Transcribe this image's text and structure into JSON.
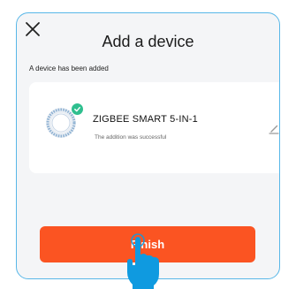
{
  "dialog": {
    "title": "Add a device",
    "subtitle": "A device has been added",
    "close_icon": "close-icon"
  },
  "device": {
    "name": "ZIGBEE SMART 5-IN-1",
    "status": "The addition was successful",
    "icon": "sensor-device-icon",
    "badge_icon": "check-icon",
    "edit_icon": "edit-pencil-icon"
  },
  "actions": {
    "finish_label": "Finish"
  },
  "colors": {
    "accent": "#fb5422",
    "frame_border": "#58b7e8",
    "success": "#2fbf8f",
    "pointer_hand": "#0f9ae0"
  }
}
